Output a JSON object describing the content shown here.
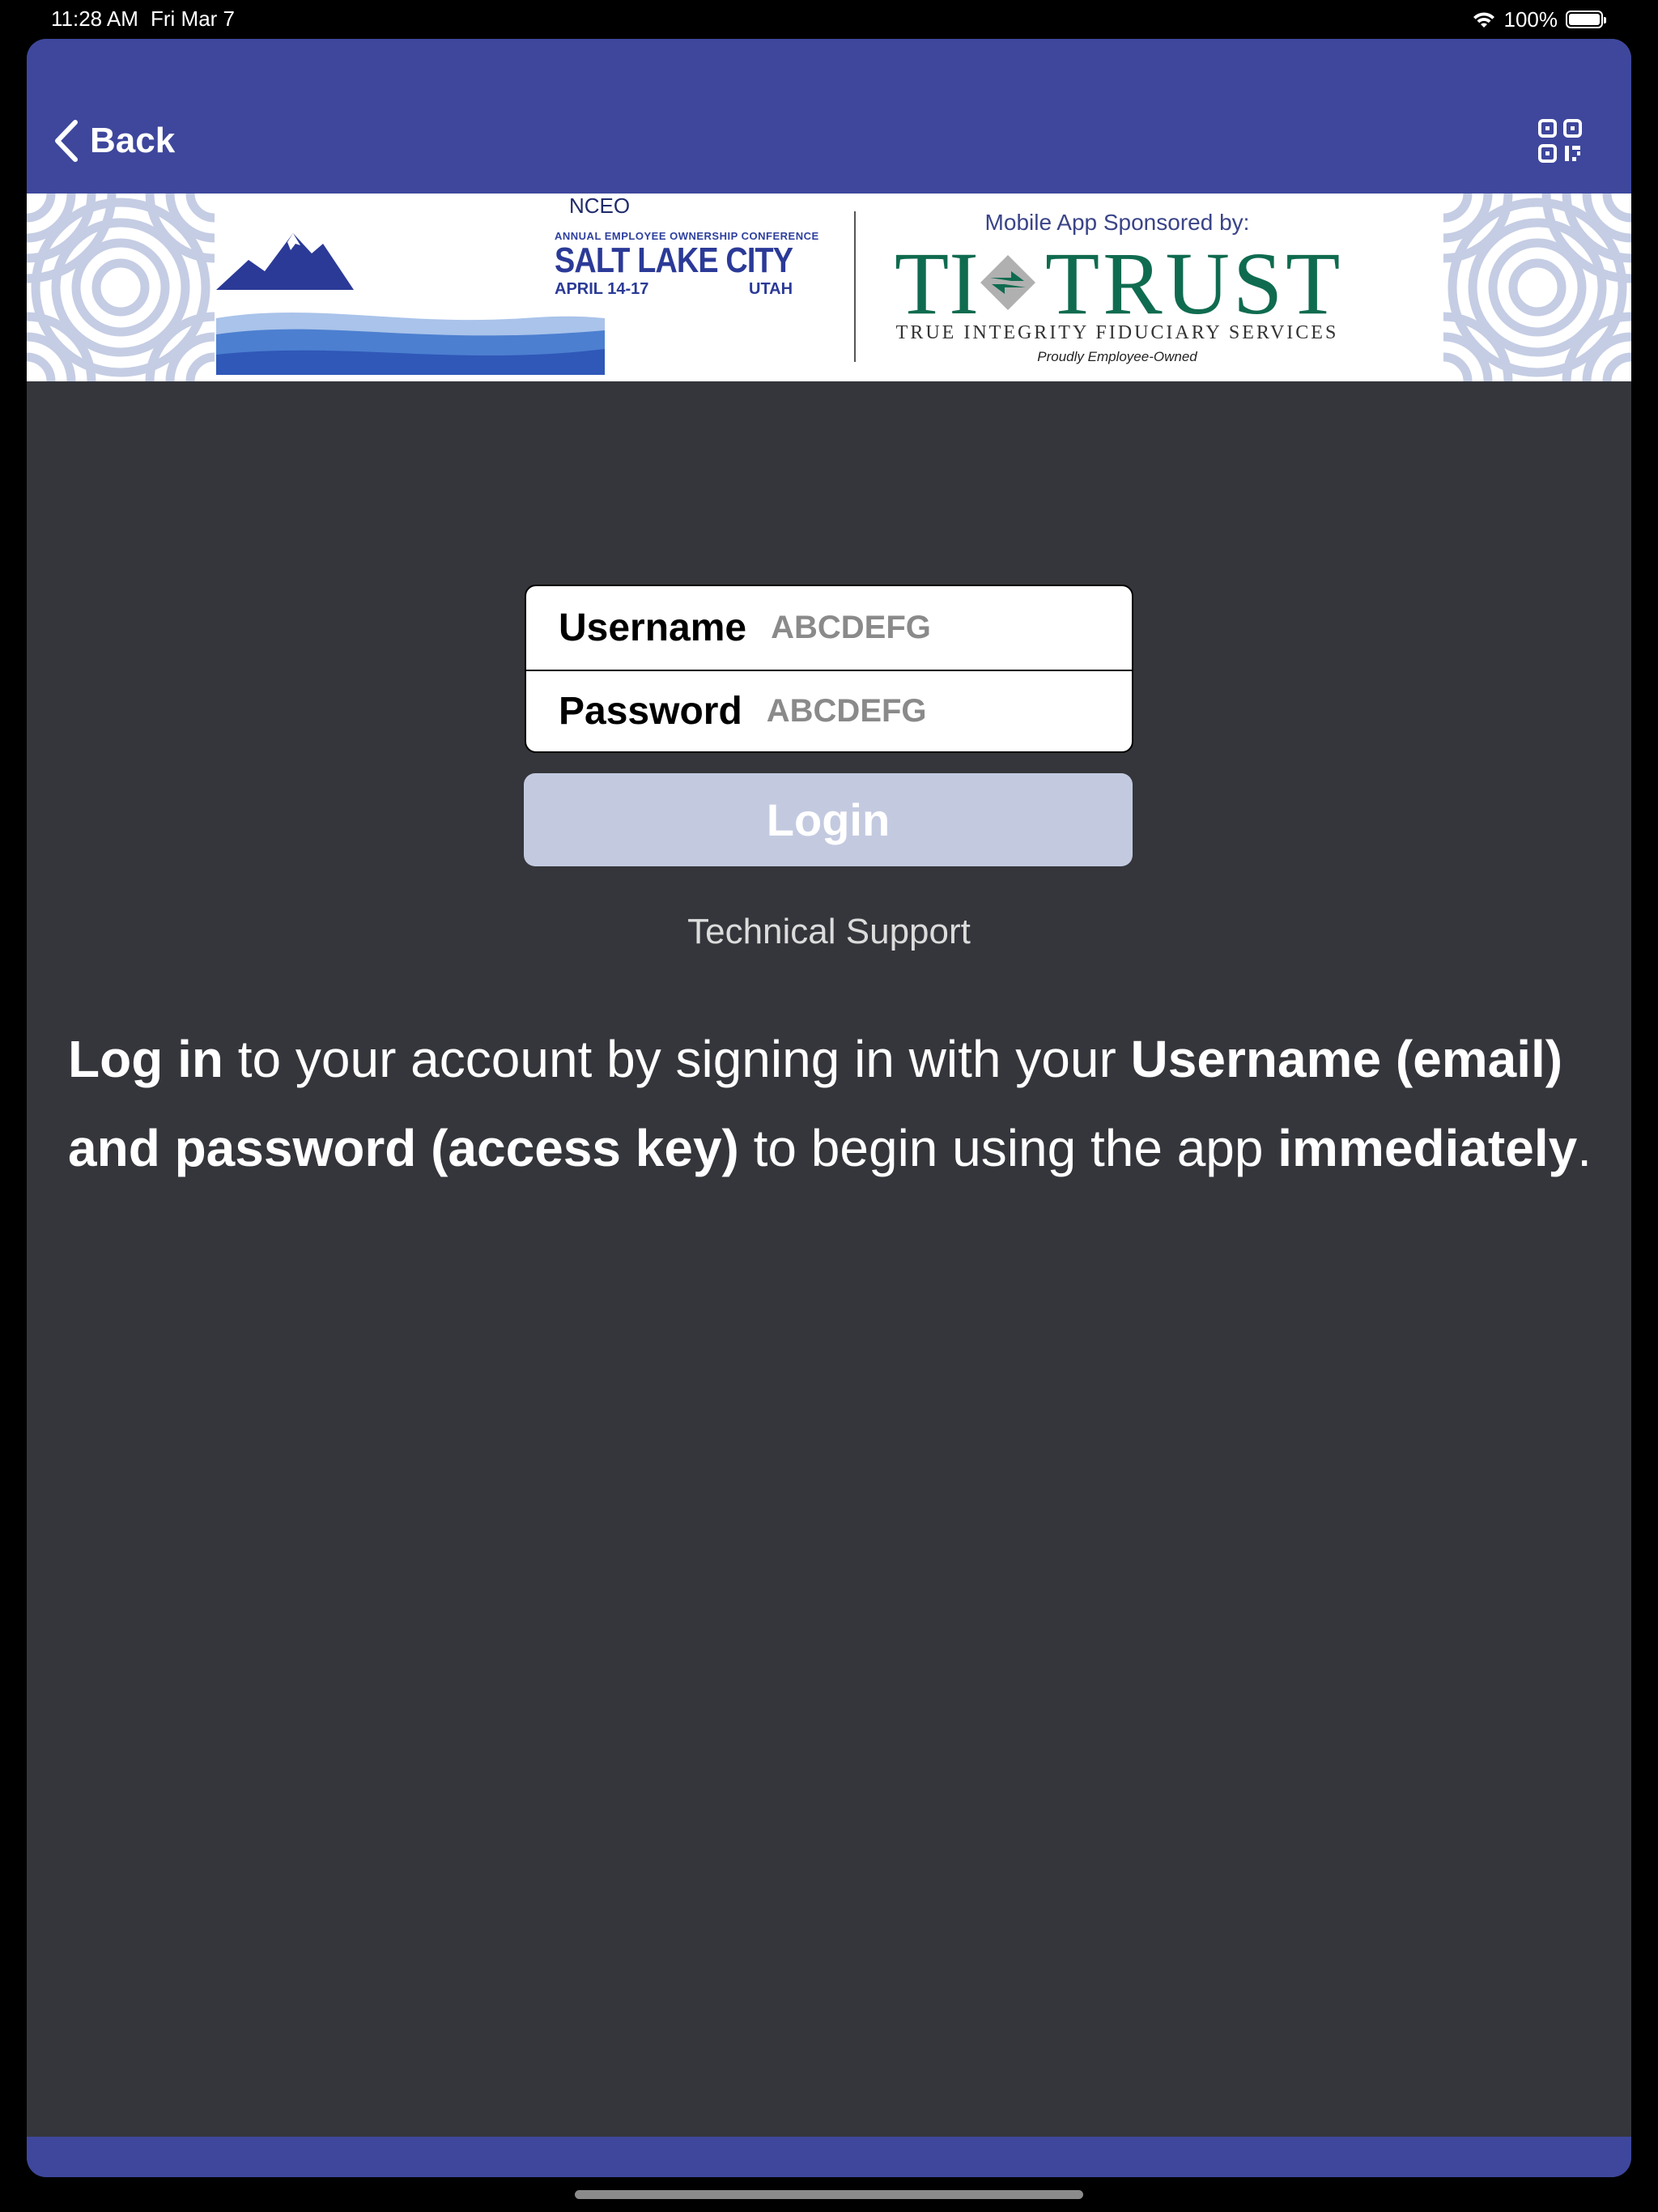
{
  "status_bar": {
    "time": "11:28 AM",
    "date": "Fri Mar 7",
    "battery": "100%",
    "battery_level_percent": 100
  },
  "nav": {
    "back_label": "Back",
    "back_icon": "chevron-left-icon",
    "qr_icon": "qr-code-icon",
    "bar_color": "#3e479c"
  },
  "banner": {
    "conference": {
      "org": "NCEO",
      "subtitle": "ANNUAL EMPLOYEE OWNERSHIP CONFERENCE",
      "city": "SALT LAKE CITY",
      "dates": "APRIL 14-17",
      "state": "UTAH"
    },
    "sponsor": {
      "label": "Mobile App Sponsored by:",
      "name_left": "TI",
      "name_right": "TRUST",
      "tagline": "TRUE INTEGRITY FIDUCIARY SERVICES",
      "subtag": "Proudly Employee-Owned",
      "brand_color": "#0f6b4f"
    }
  },
  "login": {
    "username_label": "Username",
    "username_placeholder": "ABCDEFG",
    "password_label": "Password",
    "password_placeholder": "ABCDEFG",
    "button_label": "Login",
    "support_link": "Technical Support"
  },
  "info": {
    "p1_bold": "Log in",
    "p2": " to your account by signing in with your ",
    "p3_bold": "Username (email) and password (access key)",
    "p4": " to begin using the app ",
    "p5_bold": "immediately",
    "p6": "."
  }
}
